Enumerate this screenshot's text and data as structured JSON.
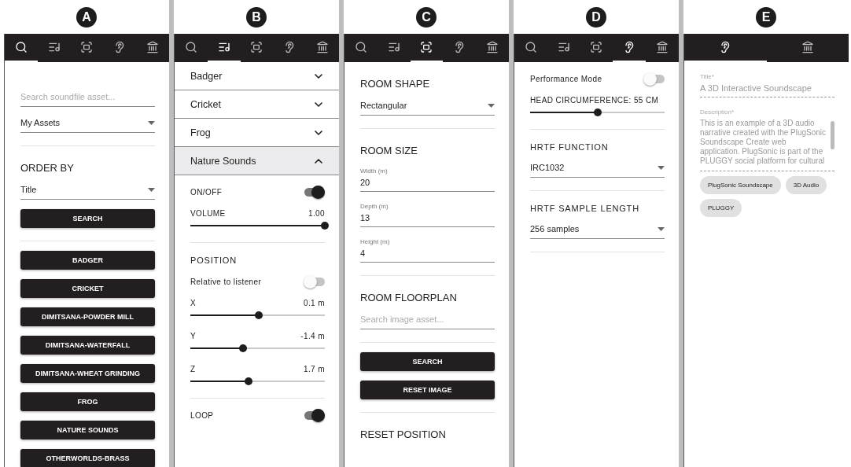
{
  "panels": [
    {
      "label": "A",
      "tabs": [
        {
          "kind": "search",
          "selected": true
        },
        {
          "kind": "playlist",
          "selected": false
        },
        {
          "kind": "frame",
          "selected": false
        },
        {
          "kind": "ear",
          "selected": false
        },
        {
          "kind": "museum",
          "selected": false
        }
      ],
      "blocks": [
        {
          "kind": "spacer"
        },
        {
          "kind": "search",
          "placeholder": "Search soundfile asset..."
        },
        {
          "kind": "select",
          "value": "My Assets"
        },
        {
          "kind": "divider"
        },
        {
          "kind": "heading",
          "text": "ORDER BY"
        },
        {
          "kind": "select",
          "value": "Title"
        },
        {
          "kind": "button",
          "label": "SEARCH"
        },
        {
          "kind": "divider"
        },
        {
          "kind": "button",
          "label": "BADGER"
        },
        {
          "kind": "button",
          "label": "CRICKET"
        },
        {
          "kind": "button",
          "label": "DIMITSANA-POWDER MILL"
        },
        {
          "kind": "button",
          "label": "DIMITSANA-WATERFALL"
        },
        {
          "kind": "button",
          "label": "DIMITSANA-WHEAT GRINDING"
        },
        {
          "kind": "button",
          "label": "FROG"
        },
        {
          "kind": "button",
          "label": "NATURE SOUNDS"
        },
        {
          "kind": "button",
          "label": "OTHERWORLDS-BRASS"
        }
      ]
    },
    {
      "label": "B",
      "tabs": [
        {
          "kind": "search",
          "selected": false
        },
        {
          "kind": "playlist",
          "selected": true
        },
        {
          "kind": "frame",
          "selected": false
        },
        {
          "kind": "ear",
          "selected": false
        },
        {
          "kind": "museum",
          "selected": false
        }
      ],
      "blocks": [
        {
          "kind": "accordion",
          "label": "Badger",
          "expanded": false
        },
        {
          "kind": "accordion",
          "label": "Cricket",
          "expanded": false
        },
        {
          "kind": "accordion",
          "label": "Frog",
          "expanded": false
        },
        {
          "kind": "accordion",
          "label": "Nature Sounds",
          "expanded": true
        },
        {
          "kind": "toggle",
          "label": "ON/OFF",
          "on": true
        },
        {
          "kind": "slider",
          "label": "VOLUME",
          "reading": "1.00",
          "level": 1.0
        },
        {
          "kind": "divider"
        },
        {
          "kind": "subheading",
          "text": "POSITION"
        },
        {
          "kind": "toggle",
          "label": "Relative to listener",
          "on": false
        },
        {
          "kind": "slider",
          "label": "X",
          "reading": "0.1 m",
          "level": 0.51
        },
        {
          "kind": "slider",
          "label": "Y",
          "reading": "-1.4 m",
          "level": 0.39
        },
        {
          "kind": "slider",
          "label": "Z",
          "reading": "1.7 m",
          "level": 0.43
        },
        {
          "kind": "divider"
        },
        {
          "kind": "toggle",
          "label": "LOOP",
          "on": true
        }
      ]
    },
    {
      "label": "C",
      "tabs": [
        {
          "kind": "search",
          "selected": false
        },
        {
          "kind": "playlist",
          "selected": false
        },
        {
          "kind": "frame",
          "selected": true
        },
        {
          "kind": "ear",
          "selected": false
        },
        {
          "kind": "museum",
          "selected": false
        }
      ],
      "blocks": [
        {
          "kind": "heading",
          "text": "ROOM SHAPE"
        },
        {
          "kind": "select",
          "value": "Rectangular"
        },
        {
          "kind": "divider"
        },
        {
          "kind": "heading",
          "text": "ROOM SIZE"
        },
        {
          "kind": "textfield",
          "label": "Width (m)",
          "value": "20"
        },
        {
          "kind": "textfield",
          "label": "Depth (m)",
          "value": "13"
        },
        {
          "kind": "textfield",
          "label": "Height (m)",
          "value": "4"
        },
        {
          "kind": "divider"
        },
        {
          "kind": "heading",
          "text": "ROOM FLOORPLAN"
        },
        {
          "kind": "search",
          "placeholder": "Search image asset..."
        },
        {
          "kind": "divider"
        },
        {
          "kind": "button",
          "label": "SEARCH"
        },
        {
          "kind": "button",
          "label": "RESET IMAGE"
        },
        {
          "kind": "divider"
        },
        {
          "kind": "heading",
          "text": "RESET POSITION"
        }
      ]
    },
    {
      "label": "D",
      "tabs": [
        {
          "kind": "search",
          "selected": false
        },
        {
          "kind": "playlist",
          "selected": false
        },
        {
          "kind": "frame",
          "selected": false
        },
        {
          "kind": "ear",
          "selected": true
        },
        {
          "kind": "museum",
          "selected": false
        }
      ],
      "blocks": [
        {
          "kind": "toggle",
          "label": "Performance Mode",
          "on": false
        },
        {
          "kind": "slider",
          "label": "HEAD CIRCUMFERENCE: 55 CM",
          "level": 0.5
        },
        {
          "kind": "divider"
        },
        {
          "kind": "subheading",
          "text": "HRTF FUNCTION"
        },
        {
          "kind": "select",
          "value": "IRC1032"
        },
        {
          "kind": "divider"
        },
        {
          "kind": "subheading",
          "text": "HRTF SAMPLE LENGTH"
        },
        {
          "kind": "select",
          "value": "256 samples"
        },
        {
          "kind": "divider"
        }
      ]
    },
    {
      "label": "E",
      "tabs": [
        {
          "kind": "ear",
          "selected": true
        },
        {
          "kind": "museum",
          "selected": false
        }
      ],
      "blocks": [
        {
          "kind": "textfield",
          "label": "Title*",
          "value": "A 3D Interactive Soundscape",
          "disabled": true
        },
        {
          "kind": "textarea",
          "label": "Description*",
          "value": "This is an example of a 3D audio narrative created with the PlugSonic Soundscape Create web application. PlugSonic is part of the PLUGGY social platform for cultural",
          "disabled": true
        },
        {
          "kind": "chips",
          "items": [
            "PlugSonic Soundscape",
            "3D Audio",
            "PLUGGY"
          ]
        }
      ]
    }
  ]
}
